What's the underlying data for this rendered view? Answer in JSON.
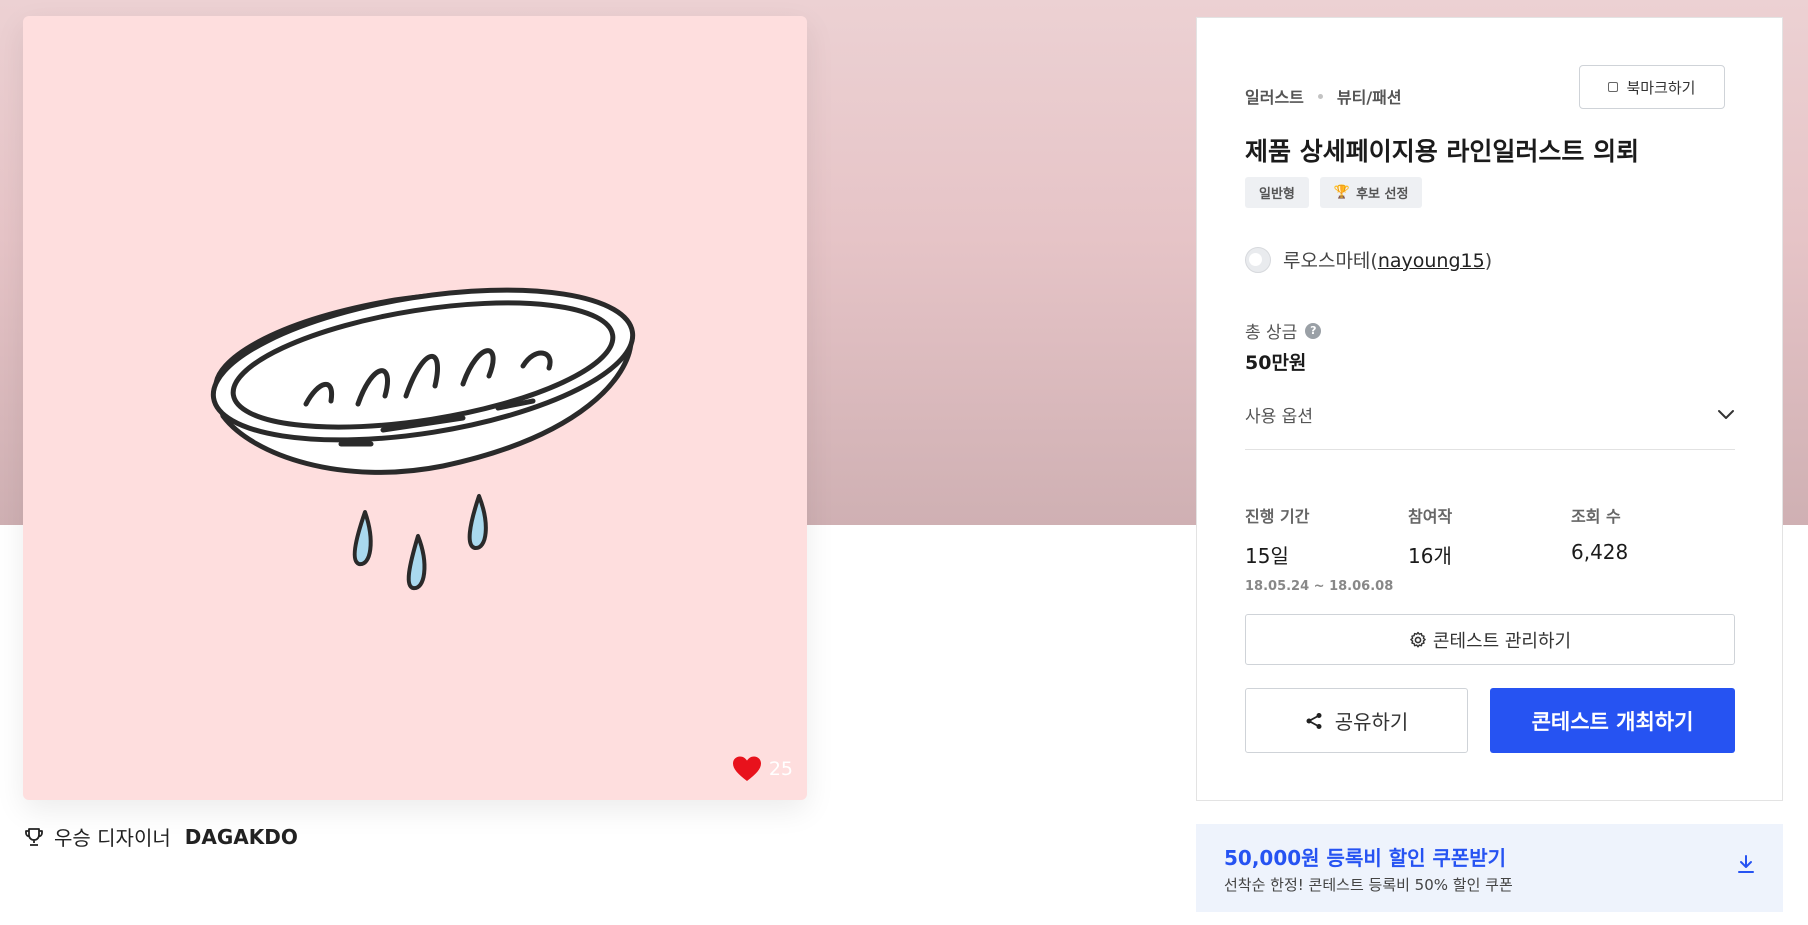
{
  "artwork": {
    "likes": "25",
    "winner_label": "우승 디자이너",
    "winner_name": "DAGAKDO"
  },
  "card": {
    "bookmark_label": "북마크하기",
    "breadcrumb": [
      "일러스트",
      "뷰티/패션"
    ],
    "title": "제품 상세페이지용 라인일러스트 의뢰",
    "badges": [
      {
        "label": "일반형"
      },
      {
        "label": "후보 선정",
        "icon": "trophy-icon"
      }
    ],
    "client_name": "루오스마테",
    "client_id": "nayoung15",
    "prize_label": "총 상금",
    "prize_value": "50만원",
    "option_label": "사용 옵션",
    "stats": [
      {
        "label": "진행 기간",
        "value": "15일",
        "sub": "18.05.24 ~ 18.06.08"
      },
      {
        "label": "참여작",
        "value": "16개"
      },
      {
        "label": "조회 수",
        "value": "6,428"
      }
    ],
    "manage_label": "콘테스트 관리하기",
    "share_label": "공유하기",
    "host_label": "콘테스트 개최하기"
  },
  "coupon": {
    "title": "50,000원 등록비 할인 쿠폰받기",
    "subtitle": "선착순 한정! 콘테스트 등록비 50% 할인 쿠폰"
  },
  "colors": {
    "accent": "#2653f2",
    "hero": "#e6c4c7",
    "artwork_bg": "#fedede",
    "like_heart": "#e8121c"
  }
}
